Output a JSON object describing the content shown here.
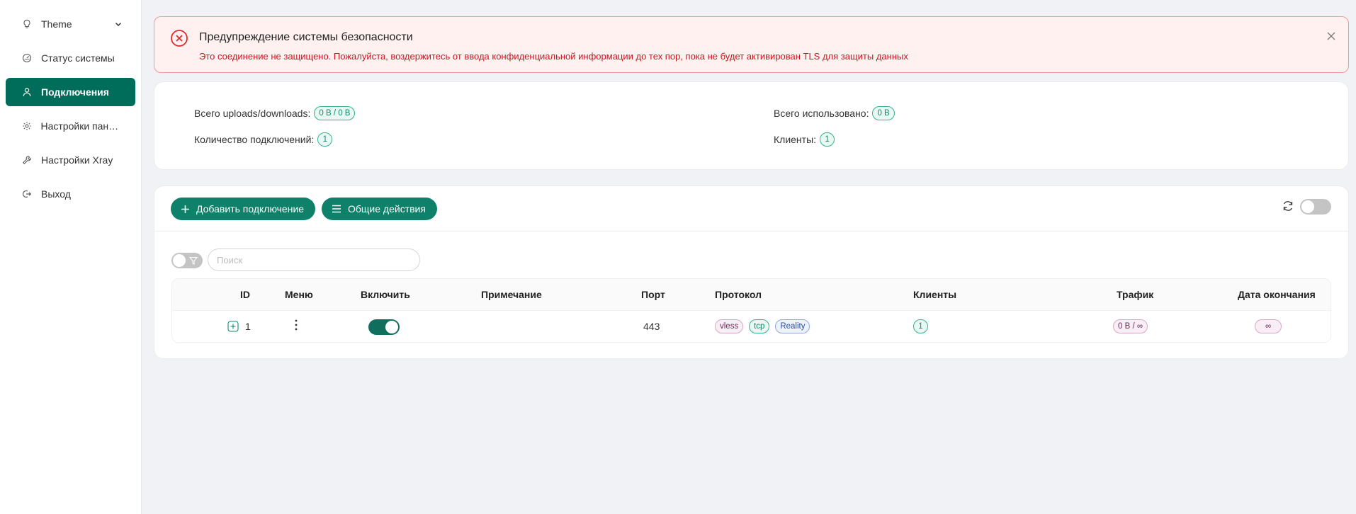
{
  "sidebar": {
    "items": [
      {
        "label": "Theme",
        "icon": "bulb-icon"
      },
      {
        "label": "Статус системы",
        "icon": "dashboard-icon"
      },
      {
        "label": "Подключения",
        "icon": "user-icon",
        "active": true
      },
      {
        "label": "Настройки пане...",
        "icon": "gear-icon"
      },
      {
        "label": "Настройки Xray",
        "icon": "tool-icon"
      },
      {
        "label": "Выход",
        "icon": "logout-icon"
      }
    ]
  },
  "alert": {
    "title": "Предупреждение системы безопасности",
    "message": "Это соединение не защищено. Пожалуйста, воздержитесь от ввода конфиденциальной информации до тех пор, пока не будет активирован TLS для защиты данных"
  },
  "stats": {
    "total_updown_label": "Всего uploads/downloads:",
    "total_updown_value": "0 B / 0 B",
    "total_used_label": "Всего использовано:",
    "total_used_value": "0 B",
    "connections_label": "Количество подключений:",
    "connections_value": "1",
    "clients_label": "Клиенты:",
    "clients_value": "1"
  },
  "toolbar": {
    "add_label": "Добавить подключение",
    "general_label": "Общие действия",
    "search_placeholder": "Поиск"
  },
  "table": {
    "headers": [
      "ID",
      "Меню",
      "Включить",
      "Примечание",
      "Порт",
      "Протокол",
      "Клиенты",
      "Трафик",
      "Дата окончания"
    ],
    "rows": [
      {
        "id": "1",
        "enabled": true,
        "remark": "",
        "port": "443",
        "protocol_tags": [
          "vless",
          "tcp",
          "Reality"
        ],
        "clients": "1",
        "traffic": "0 B / ∞",
        "expiry": "∞"
      }
    ]
  },
  "colors": {
    "accent": "#006d5a",
    "alert_bg": "#fff1f0",
    "alert_text": "#cf1322"
  }
}
